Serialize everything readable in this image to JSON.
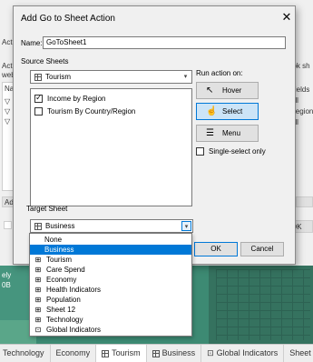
{
  "background": {
    "left_text_1": "Actio",
    "left_text_2": "Actio",
    "left_text_3": "web",
    "left_text_4": "Na",
    "right_text_1": "ook sh",
    "right_text_2": "Fields",
    "right_text_3": "All",
    "right_text_4": "Region",
    "right_text_5": "All",
    "add_button": "Ad",
    "ok_fragment": "OK",
    "treemap_label_1": "ely",
    "treemap_label_2": "0B"
  },
  "sheet_tabs": [
    {
      "label": "Technology",
      "icon": ""
    },
    {
      "label": "Economy",
      "icon": ""
    },
    {
      "label": "Tourism",
      "icon": "grid-icon"
    },
    {
      "label": "Business",
      "icon": "grid-icon"
    },
    {
      "label": "Global Indicators",
      "icon": "dashboard-icon"
    },
    {
      "label": "Sheet 1",
      "icon": ""
    }
  ],
  "dialog": {
    "title": "Add Go to Sheet Action",
    "close_glyph": "✕",
    "name_label": "Name:",
    "name_value": "GoToSheet1",
    "source_sheets_label": "Source Sheets",
    "source_combo_value": "Tourism",
    "sheets": [
      {
        "label": "Income by Region",
        "checked": true
      },
      {
        "label": "Tourism By Country/Region",
        "checked": false
      }
    ],
    "run_action_label": "Run action on:",
    "actions": [
      {
        "label": "Hover",
        "icon": "cursor-icon",
        "glyph": "↖"
      },
      {
        "label": "Select",
        "icon": "hand-pointer-icon",
        "glyph": "☝"
      },
      {
        "label": "Menu",
        "icon": "menu-icon",
        "glyph": "☰"
      }
    ],
    "single_select_label": "Single-select only",
    "target_sheet_label": "Target Sheet",
    "target_combo_value": "Business",
    "ok_label": "OK",
    "cancel_label": "Cancel"
  },
  "dropdown": {
    "options": [
      {
        "label": "None",
        "icon": ""
      },
      {
        "label": "Business",
        "icon": ""
      },
      {
        "label": "Tourism",
        "icon": "grid-icon"
      },
      {
        "label": "Care Spend",
        "icon": "grid-icon"
      },
      {
        "label": "Economy",
        "icon": "grid-icon"
      },
      {
        "label": "Health Indicators",
        "icon": "grid-icon"
      },
      {
        "label": "Population",
        "icon": "grid-icon"
      },
      {
        "label": "Sheet 12",
        "icon": "grid-icon"
      },
      {
        "label": "Technology",
        "icon": "grid-icon"
      },
      {
        "label": "Global Indicators",
        "icon": "dashboard-icon"
      }
    ],
    "highlighted_index": 1
  },
  "colors": {
    "accent": "#0078d7",
    "selected_button_bg": "#cce4f7",
    "treemap_green": "#3f8f7a"
  }
}
